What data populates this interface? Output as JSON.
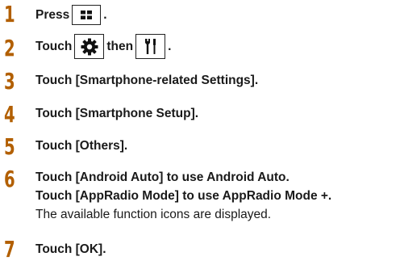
{
  "steps": [
    {
      "number": "1",
      "before": "Press",
      "after": "."
    },
    {
      "number": "2",
      "before": "Touch",
      "middle": "then",
      "after": "."
    },
    {
      "number": "3",
      "text": "Touch [Smartphone-related Settings]."
    },
    {
      "number": "4",
      "text": "Touch [Smartphone Setup]."
    },
    {
      "number": "5",
      "text": "Touch [Others]."
    },
    {
      "number": "6",
      "line1": "Touch [Android Auto] to use Android Auto.",
      "line2": "Touch [AppRadio Mode] to use AppRadio Mode +.",
      "note": "The available function icons are displayed."
    },
    {
      "number": "7",
      "text": "Touch [OK]."
    }
  ],
  "icons": {
    "home": "home-grid-icon",
    "settings": "gear-icon",
    "tools": "tools-icon"
  },
  "colors": {
    "step_number": "#b25f00",
    "text": "#1a1a1a"
  }
}
